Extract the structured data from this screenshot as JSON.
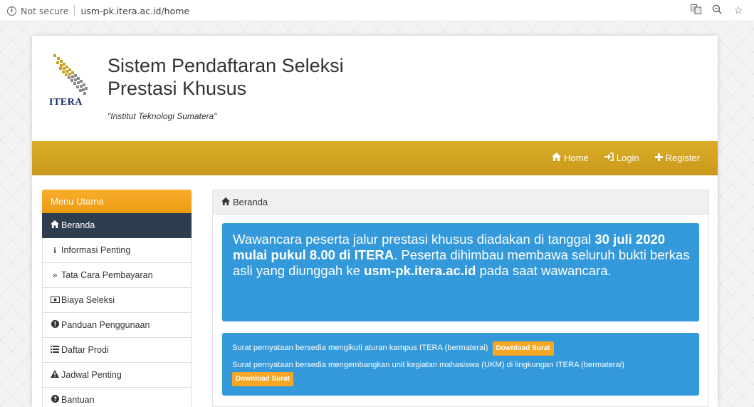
{
  "browser": {
    "security_label": "Not secure",
    "url": "usm-pk.itera.ac.id/home",
    "info_icon": "info-circle-icon",
    "icons": [
      "translate-icon",
      "zoom-icon",
      "bookmark-star-icon"
    ]
  },
  "header": {
    "logo_text": "ITERA",
    "title": "Sistem Pendaftaran Seleksi Prestasi Khusus",
    "tagline": "\"Institut Teknologi Sumatera\""
  },
  "nav": {
    "items": [
      {
        "label": "Home",
        "icon": "home-icon"
      },
      {
        "label": "Login",
        "icon": "login-icon"
      },
      {
        "label": "Register",
        "icon": "plus-icon"
      }
    ]
  },
  "sidebar": {
    "title": "Menu Utama",
    "items": [
      {
        "label": "Beranda",
        "icon": "home-icon",
        "active": true
      },
      {
        "label": "Informasi Penting",
        "icon": "info-icon"
      },
      {
        "label": "Tata Cara Pembayaran",
        "icon": "double-chevron-right-icon"
      },
      {
        "label": "Biaya Seleksi",
        "icon": "money-icon"
      },
      {
        "label": "Panduan Penggunaan",
        "icon": "exclamation-circle-icon"
      },
      {
        "label": "Daftar Prodi",
        "icon": "list-icon"
      },
      {
        "label": "Jadwal Penting",
        "icon": "warning-icon"
      },
      {
        "label": "Bantuan",
        "icon": "question-circle-icon"
      }
    ]
  },
  "main": {
    "breadcrumb": "Beranda",
    "announcement": {
      "part1": "Wawancara peserta jalur prestasi khusus diadakan di tanggal ",
      "bold1": "30 juli 2020 mulai pukul 8.00 di ITERA",
      "part2": ". Peserta dihimbau membawa seluruh bukti berkas asli yang diunggah ke ",
      "bold2": "usm-pk.itera.ac.id",
      "part3": " pada saat wawancara."
    },
    "downloads": [
      {
        "text": "Surat pernyataan bersedia mengikuti aturan kampus ITERA (bermaterai)",
        "button": "Download Surat"
      },
      {
        "text": "Surat pernyataan bersedia mengembangkan unit kegiatan mahasiswa (UKM) di lingkungan ITERA (bermaterai)",
        "button": "Download Surat"
      }
    ]
  },
  "colors": {
    "navbar": "#d4a520",
    "sidebar_head": "#f5a623",
    "active_item": "#2f3e4e",
    "alert": "#3399da",
    "button": "#f5a623"
  }
}
